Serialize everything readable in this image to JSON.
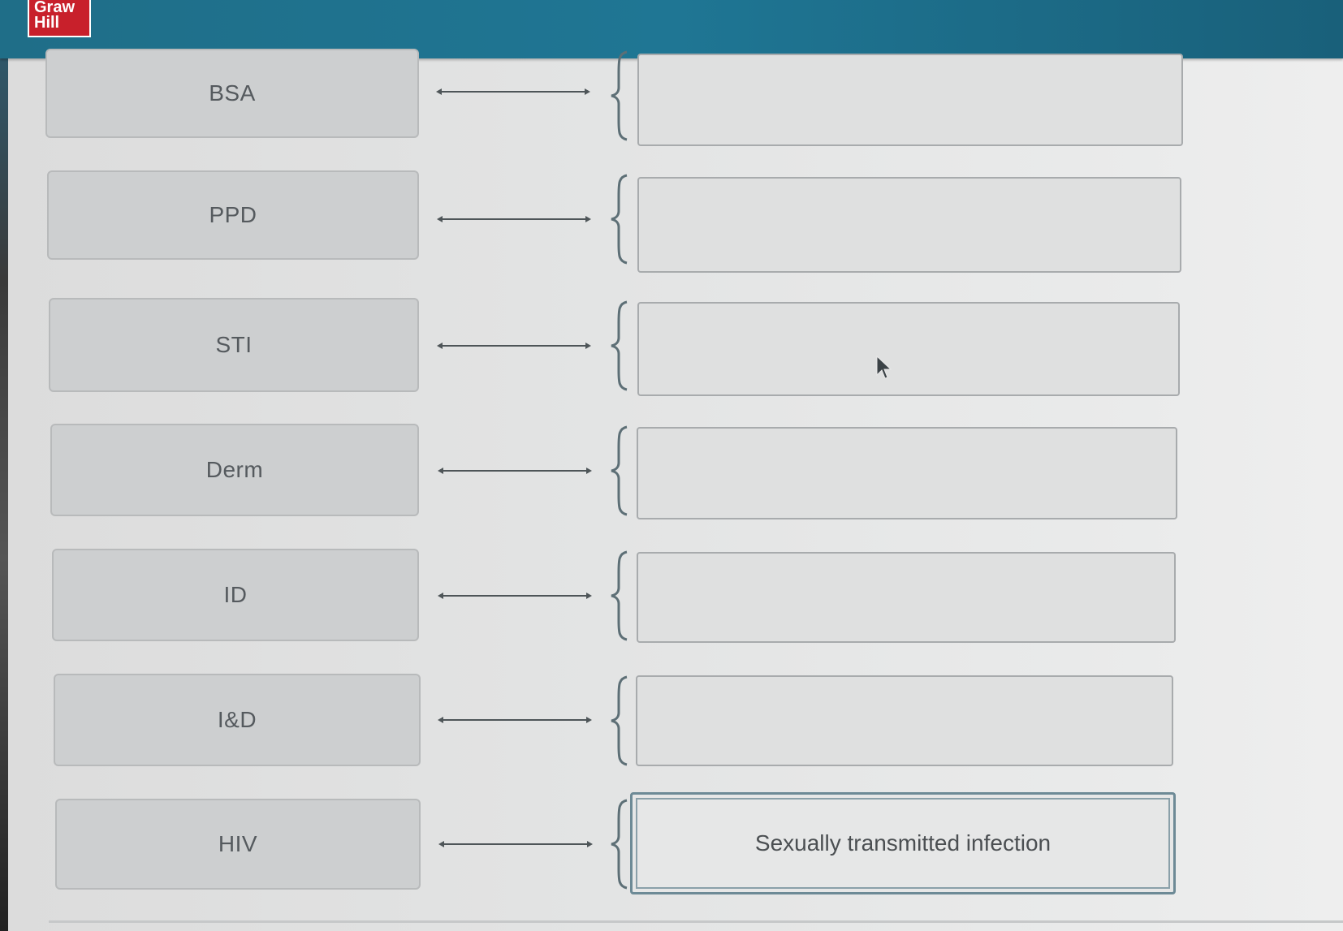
{
  "brand": {
    "logo_line1": "Graw",
    "logo_line2": "Hill",
    "color": "#c8202b"
  },
  "accent": "#1f7694",
  "pairs": [
    {
      "term": "BSA",
      "definition": ""
    },
    {
      "term": "PPD",
      "definition": ""
    },
    {
      "term": "STI",
      "definition": ""
    },
    {
      "term": "Derm",
      "definition": ""
    },
    {
      "term": "ID",
      "definition": ""
    },
    {
      "term": "I&D",
      "definition": ""
    },
    {
      "term": "HIV",
      "definition": "Sexually transmitted infection"
    }
  ]
}
